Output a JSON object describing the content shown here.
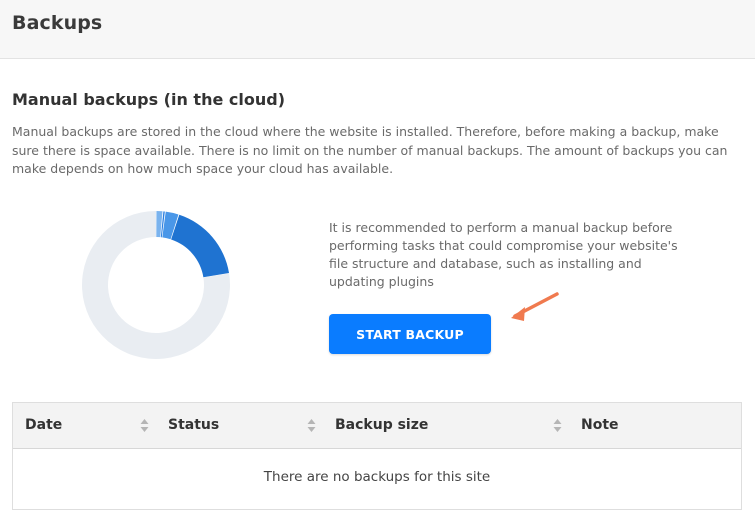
{
  "header": {
    "title": "Backups"
  },
  "manual": {
    "title": "Manual backups (in the cloud)",
    "description": "Manual backups are stored in the cloud where the website is installed. Therefore, before making a backup, make sure there is space available. There is no limit on the number of manual backups. The amount of backups you can make depends on how much space your cloud has available.",
    "recommendation": "It is recommended to perform a manual backup before performing tasks that could compromise your website's file structure and database, such as installing and updating plugins",
    "start_button_label": "START BACKUP"
  },
  "storage_chart": {
    "type": "donut",
    "segments": [
      {
        "fraction": 0.015,
        "color": "#7ab3ee"
      },
      {
        "fraction": 0.005,
        "color": "#2b7fe0"
      },
      {
        "fraction": 0.03,
        "color": "#4a97e8"
      },
      {
        "fraction": 0.175,
        "color": "#1f73d1"
      },
      {
        "fraction": 0.775,
        "color": "#e9edf2"
      }
    ]
  },
  "table": {
    "columns": [
      {
        "label": "Date",
        "sortable": true
      },
      {
        "label": "Status",
        "sortable": true
      },
      {
        "label": "Backup size",
        "sortable": true
      },
      {
        "label": "Note",
        "sortable": false
      }
    ],
    "empty_message": "There are no backups for this site"
  },
  "colors": {
    "accent": "#0a7cff",
    "arrow": "#f07a4f"
  }
}
